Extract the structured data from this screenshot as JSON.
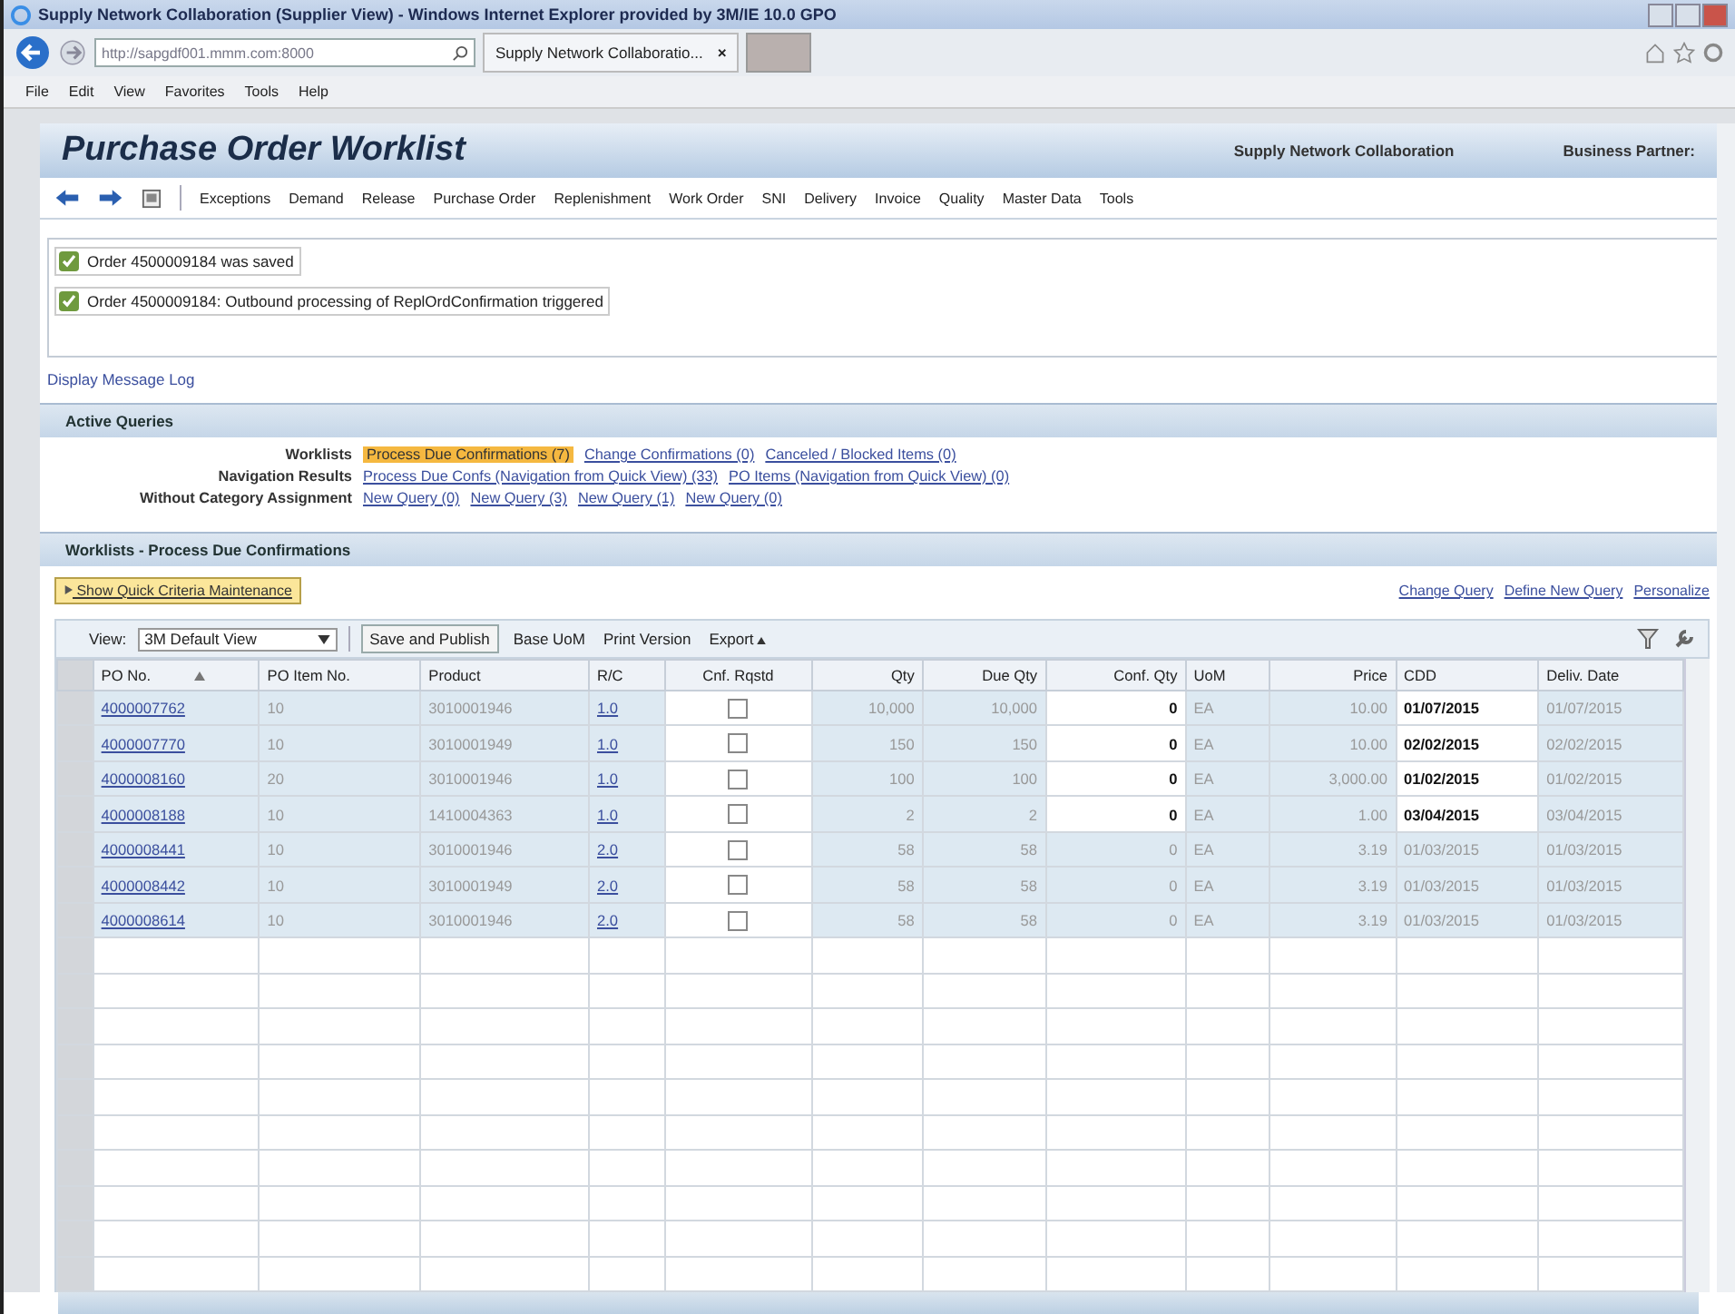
{
  "browser": {
    "title": "Supply Network Collaboration (Supplier View) - Windows Internet Explorer provided by 3M/IE 10.0 GPO",
    "url": "http://sapgdf001.mmm.com:8000",
    "tab_title": "Supply Network Collaboratio...",
    "tab_close": "×",
    "menu": [
      "File",
      "Edit",
      "View",
      "Favorites",
      "Tools",
      "Help"
    ]
  },
  "header": {
    "title": "Purchase Order Worklist",
    "app_name": "Supply Network Collaboration",
    "partner_label": "Business Partner:"
  },
  "nav": [
    "Exceptions",
    "Demand",
    "Release",
    "Purchase Order",
    "Replenishment",
    "Work Order",
    "SNI",
    "Delivery",
    "Invoice",
    "Quality",
    "Master Data",
    "Tools"
  ],
  "messages": [
    "Order 4500009184 was saved",
    "Order 4500009184: Outbound processing of ReplOrdConfirmation triggered"
  ],
  "message_log_link": "Display Message Log",
  "active_queries": {
    "title": "Active Queries",
    "rows": [
      {
        "label": "Worklists",
        "links": [
          {
            "text": "Process Due Confirmations (7)",
            "selected": true
          },
          {
            "text": "Change Confirmations (0)",
            "selected": false
          },
          {
            "text": "Canceled / Blocked Items (0)",
            "selected": false
          }
        ]
      },
      {
        "label": "Navigation Results",
        "links": [
          {
            "text": "Process Due Confs (Navigation from Quick View) (33)",
            "selected": false
          },
          {
            "text": "PO Items (Navigation from Quick View) (0)",
            "selected": false
          }
        ]
      },
      {
        "label": "Without Category Assignment",
        "links": [
          {
            "text": "New Query (0)",
            "selected": false
          },
          {
            "text": "New Query (3)",
            "selected": false
          },
          {
            "text": "New Query (1)",
            "selected": false
          },
          {
            "text": "New Query (0)",
            "selected": false
          }
        ]
      }
    ]
  },
  "worklist": {
    "title": "Worklists - Process Due Confirmations",
    "quick_criteria": "Show Quick Criteria Maintenance",
    "actions": [
      "Change Query",
      "Define New Query",
      "Personalize"
    ],
    "view_label": "View:",
    "view_value": "3M Default View",
    "toolbar": [
      "Save and Publish",
      "Base UoM",
      "Print Version",
      "Export"
    ],
    "columns": [
      "PO No.",
      "PO Item No.",
      "Product",
      "R/C",
      "Cnf. Rqstd",
      "Qty",
      "Due Qty",
      "Conf. Qty",
      "UoM",
      "Price",
      "CDD",
      "Deliv. Date"
    ],
    "rows": [
      {
        "po": "4000007762",
        "item": "10",
        "product": "3010001946",
        "rc": "1.0",
        "requested": false,
        "qty": "10,000",
        "due": "10,000",
        "conf": "0",
        "uom": "EA",
        "price": "10.00",
        "cdd": "01/07/2015",
        "deliv": "01/07/2015",
        "editable": true
      },
      {
        "po": "4000007770",
        "item": "10",
        "product": "3010001949",
        "rc": "1.0",
        "requested": false,
        "qty": "150",
        "due": "150",
        "conf": "0",
        "uom": "EA",
        "price": "10.00",
        "cdd": "02/02/2015",
        "deliv": "02/02/2015",
        "editable": true
      },
      {
        "po": "4000008160",
        "item": "20",
        "product": "3010001946",
        "rc": "1.0",
        "requested": false,
        "qty": "100",
        "due": "100",
        "conf": "0",
        "uom": "EA",
        "price": "3,000.00",
        "cdd": "01/02/2015",
        "deliv": "01/02/2015",
        "editable": true
      },
      {
        "po": "4000008188",
        "item": "10",
        "product": "1410004363",
        "rc": "1.0",
        "requested": false,
        "qty": "2",
        "due": "2",
        "conf": "0",
        "uom": "EA",
        "price": "1.00",
        "cdd": "03/04/2015",
        "deliv": "03/04/2015",
        "editable": true
      },
      {
        "po": "4000008441",
        "item": "10",
        "product": "3010001946",
        "rc": "2.0",
        "requested": false,
        "qty": "58",
        "due": "58",
        "conf": "0",
        "uom": "EA",
        "price": "3.19",
        "cdd": "01/03/2015",
        "deliv": "01/03/2015",
        "editable": false
      },
      {
        "po": "4000008442",
        "item": "10",
        "product": "3010001949",
        "rc": "2.0",
        "requested": false,
        "qty": "58",
        "due": "58",
        "conf": "0",
        "uom": "EA",
        "price": "3.19",
        "cdd": "01/03/2015",
        "deliv": "01/03/2015",
        "editable": false
      },
      {
        "po": "4000008614",
        "item": "10",
        "product": "3010001946",
        "rc": "2.0",
        "requested": false,
        "qty": "58",
        "due": "58",
        "conf": "0",
        "uom": "EA",
        "price": "3.19",
        "cdd": "01/03/2015",
        "deliv": "01/03/2015",
        "editable": false
      }
    ]
  }
}
